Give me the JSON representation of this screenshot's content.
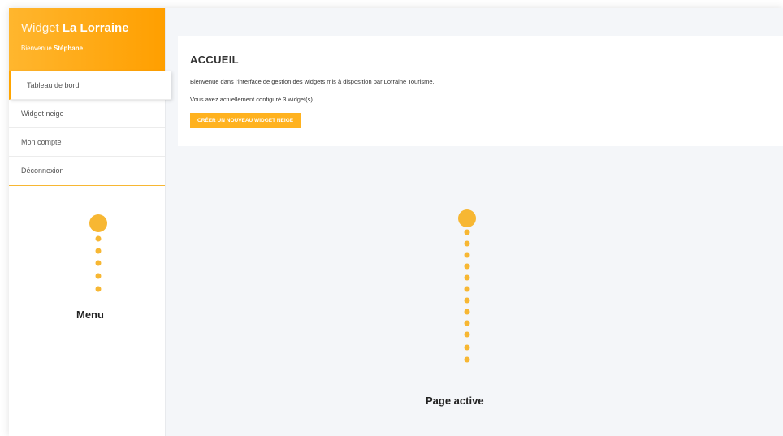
{
  "brand": {
    "title_light": "Widget",
    "title_bold": "La Lorraine",
    "welcome_prefix": "Bienvenue",
    "user_name": "Stéphane"
  },
  "menu": {
    "items": [
      {
        "label": "Tableau de bord",
        "active": true
      },
      {
        "label": "Widget neige"
      },
      {
        "label": "Mon compte"
      },
      {
        "label": "Déconnexion"
      }
    ]
  },
  "main": {
    "title": "ACCUEIL",
    "intro": "Bienvenue dans l'interface de gestion des widgets mis à disposition par Lorraine Tourisme.",
    "count_text": "Vous avez actuellement configuré 3 widget(s).",
    "create_button": "CRÉER UN NOUVEAU WIDGET NEIGE"
  },
  "annotations": {
    "menu_label": "Menu",
    "page_label": "Page active"
  },
  "colors": {
    "accent": "#ffa500",
    "dot": "#f7b733"
  }
}
